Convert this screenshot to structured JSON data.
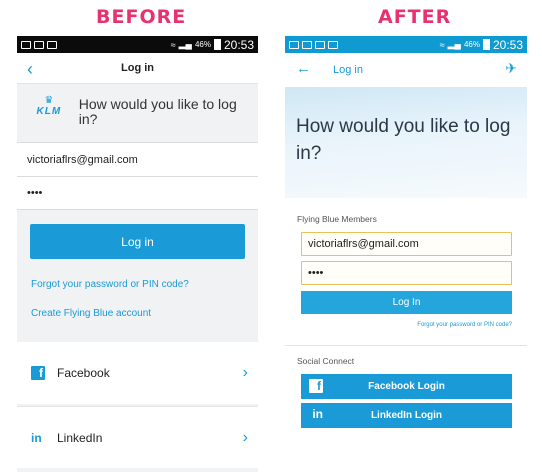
{
  "captions": {
    "before": "BEFORE",
    "after": "AFTER"
  },
  "status_bar": {
    "battery": "46%",
    "time": "20:53"
  },
  "before": {
    "title": "Log in",
    "logo_text": "KLM",
    "question": "How would you like to log in?",
    "email_value": "victoriaflrs@gmail.com",
    "password_value": "••••",
    "login_button": "Log in",
    "forgot_link": "Forgot your password or PIN code?",
    "create_link": "Create Flying Blue account",
    "social": [
      {
        "label": "Facebook",
        "icon": "facebook-icon"
      },
      {
        "label": "LinkedIn",
        "icon": "linkedin-icon"
      }
    ]
  },
  "after": {
    "title": "Log in",
    "hero_title": "How would you like to log in?",
    "members_label": "Flying Blue Members",
    "email_value": "victoriaflrs@gmail.com",
    "password_value": "••••",
    "login_button": "Log In",
    "forgot_link": "Forgot your password or PIN code?",
    "social_label": "Social Connect",
    "facebook_button": "Facebook Login",
    "linkedin_button": "LinkedIn Login"
  },
  "colors": {
    "accent": "#1a9bd7",
    "after_status_bar": "#0f9bd1",
    "before_status_bar": "#0b0b0b",
    "field_border": "#e8c15d",
    "caption": "#e8316f"
  }
}
